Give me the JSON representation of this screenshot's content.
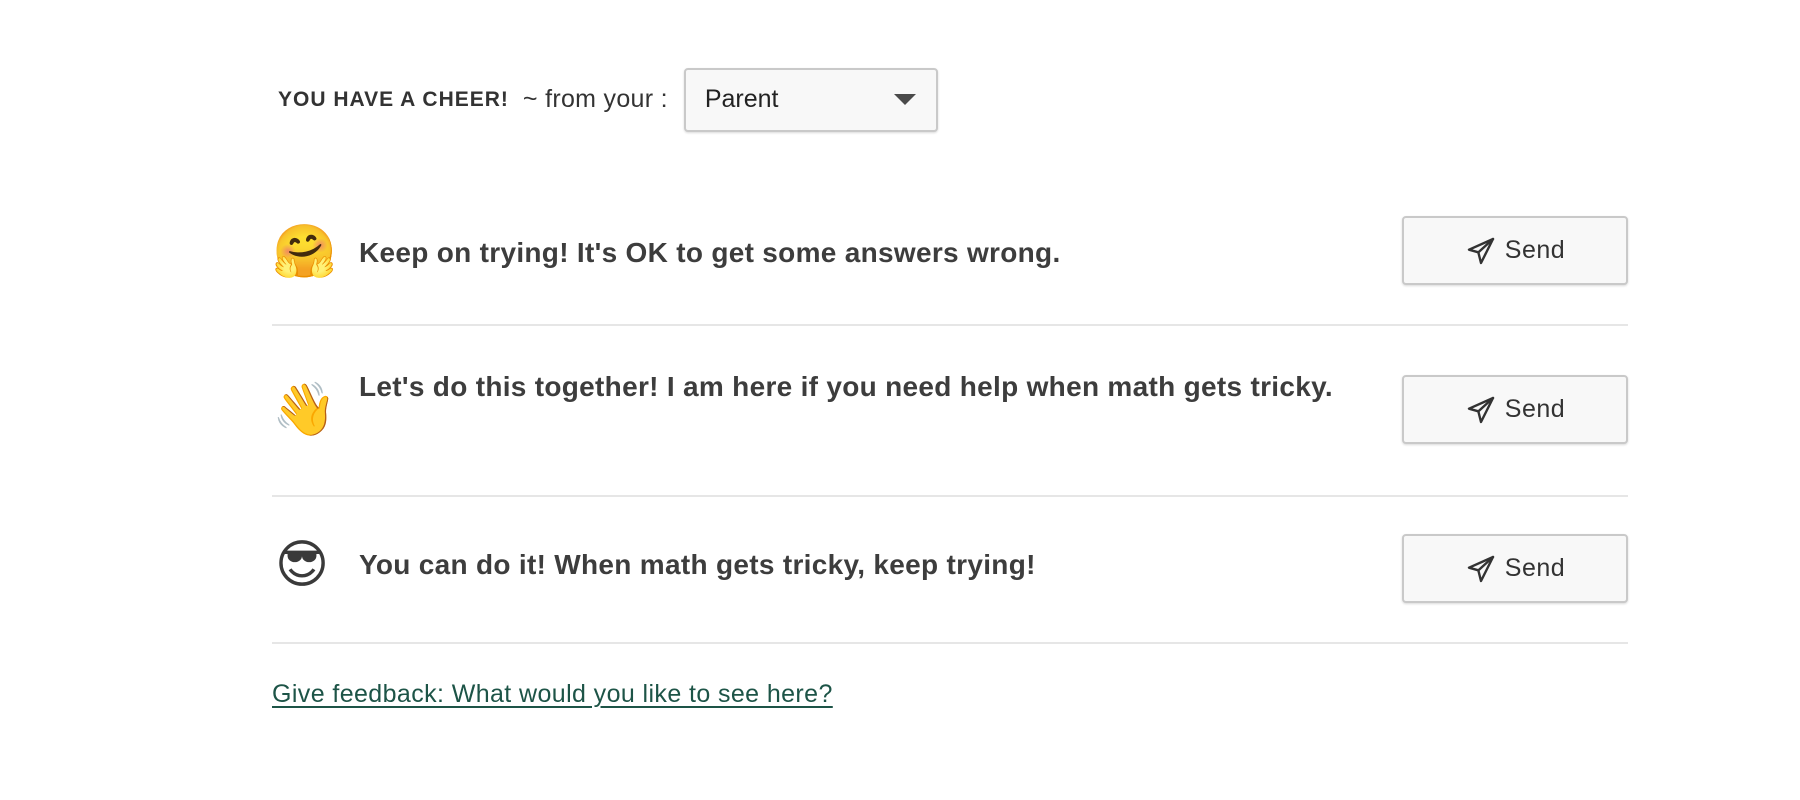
{
  "header": {
    "cheer_title": "YOU HAVE A CHEER!",
    "from_label": "~ from your :",
    "relation_select": {
      "value": "Parent"
    }
  },
  "cheers": [
    {
      "emoji": "🤗",
      "emoji_name": "hugging-face",
      "message": "Keep on trying! It's OK to get some answers wrong.",
      "send_label": "Send"
    },
    {
      "emoji": "👋",
      "emoji_name": "waving-hand",
      "message": "Let's do this together! I am here if you need help when math gets tricky.",
      "send_label": "Send"
    },
    {
      "emoji": "😎",
      "emoji_name": "sunglasses-face",
      "message": "You can do it! When math gets tricky, keep trying!",
      "send_label": "Send"
    }
  ],
  "feedback_link": "Give feedback: What would you like to see here?",
  "colors": {
    "link": "#1d5447",
    "divider": "#e6e6e6",
    "button_border": "#c9c9c9"
  }
}
